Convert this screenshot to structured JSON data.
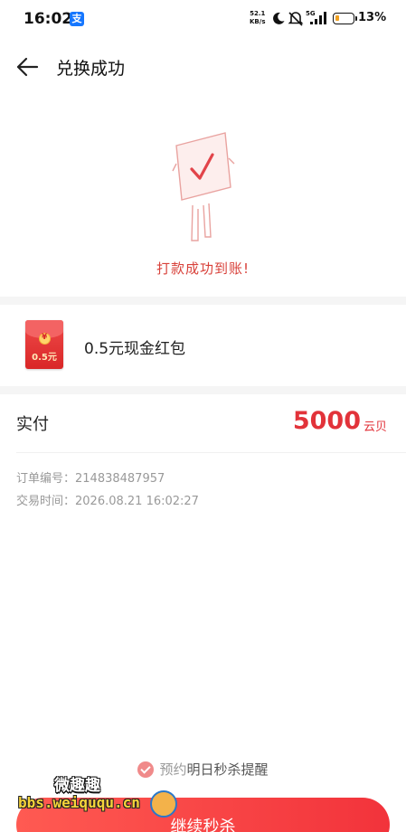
{
  "status_bar": {
    "time": "16:02",
    "net_speed_value": "52.1",
    "net_speed_unit": "KB/s",
    "signal_label": "5G",
    "battery": "13%"
  },
  "header": {
    "title": "兑换成功"
  },
  "result": {
    "message": "打款成功到账!"
  },
  "product": {
    "name": "0.5元现金红包",
    "packet_amount": "0.5元"
  },
  "payment": {
    "label": "实付",
    "amount": "5000",
    "unit": "云贝"
  },
  "order": {
    "number_line": "订单编号：214838487957",
    "time_line": "交易时间：2026.08.21 16:02:27"
  },
  "reminder": {
    "prefix": "预约",
    "text": "明日秒杀提醒"
  },
  "cta": {
    "label": "继续秒杀"
  },
  "watermark": {
    "title": "微趣趣",
    "url": "bbs.weiququ.cn"
  },
  "colors": {
    "accent": "#e2333a",
    "success_text": "#d8413a",
    "button": "#f2333b"
  }
}
